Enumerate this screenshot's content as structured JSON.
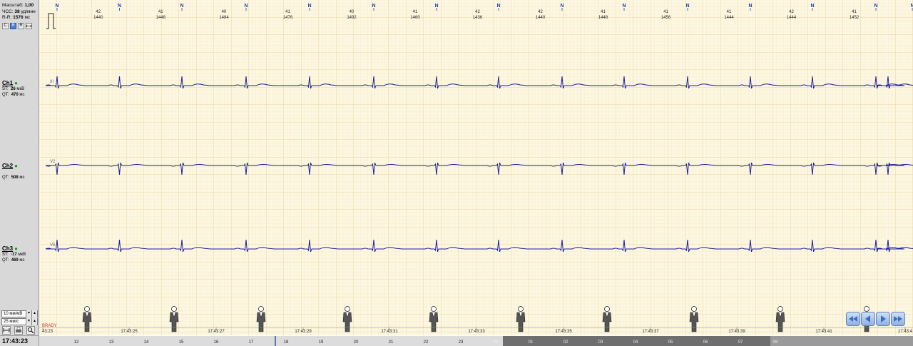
{
  "left_panel": {
    "scale_label": "Масштаб:",
    "scale_value": "1,00",
    "hr_label": "ЧСС:",
    "hr_value": "38",
    "hr_unit": "уд/мин",
    "rr_label": "R-R:",
    "rr_value": "1576",
    "rr_unit": "мс",
    "mode_buttons": [
      "C",
      "R",
      "R"
    ],
    "channels": [
      {
        "name": "Ch1",
        "st_label": "ST:",
        "st_value": "26",
        "st_unit": "мкВ",
        "qt_label": "QT:",
        "qt_value": "470",
        "qt_unit": "мс"
      },
      {
        "name": "Ch2",
        "st_label": "ST:",
        "st_value": "",
        "st_unit": "",
        "qt_label": "QT:",
        "qt_value": "508",
        "qt_unit": "мс"
      },
      {
        "name": "Ch3",
        "st_label": "ST:",
        "st_value": "-17",
        "st_unit": "мкВ",
        "qt_label": "QT:",
        "qt_value": "469",
        "qt_unit": "мс"
      }
    ],
    "amplitude_select": "10 мм/мВ",
    "speed_select": "25 мм/с",
    "current_time": "17:43:23"
  },
  "beats": [
    {
      "label": "N",
      "hr": "",
      "rr": ""
    },
    {
      "label": "N",
      "hr": "42",
      "rr": "1440"
    },
    {
      "label": "N",
      "hr": "41",
      "rr": "1448"
    },
    {
      "label": "N",
      "hr": "40",
      "rr": "1484"
    },
    {
      "label": "N",
      "hr": "41",
      "rr": "1476"
    },
    {
      "label": "N",
      "hr": "40",
      "rr": "1492"
    },
    {
      "label": "N",
      "hr": "41",
      "rr": "1460"
    },
    {
      "label": "N",
      "hr": "42",
      "rr": "1436"
    },
    {
      "label": "N",
      "hr": "42",
      "rr": "1440"
    },
    {
      "label": "N",
      "hr": "41",
      "rr": "1448"
    },
    {
      "label": "N",
      "hr": "41",
      "rr": "1456"
    },
    {
      "label": "N",
      "hr": "41",
      "rr": "1444"
    },
    {
      "label": "N",
      "hr": "42",
      "rr": "1444"
    },
    {
      "label": "N",
      "hr": "41",
      "rr": "1452"
    },
    {
      "label": "N",
      "hr": "",
      "rr": ""
    }
  ],
  "lead_labels": [
    "III",
    "V2",
    "V5"
  ],
  "event_label": "BRADY",
  "time_ticks": [
    "43:23",
    "17:43:25",
    "17:43:27",
    "17:43:29",
    "17:43:31",
    "17:43:33",
    "17:43:35",
    "17:43:37",
    "17:43:39",
    "17:43:41",
    "17:43:4"
  ],
  "overview_hours": [
    "12",
    "13",
    "14",
    "15",
    "16",
    "17",
    "18",
    "19",
    "20",
    "21",
    "22",
    "23",
    "00",
    "01",
    "02",
    "03",
    "04",
    "05",
    "06",
    "07",
    "08"
  ],
  "colors": {
    "grid_bg": "#fdf7e2",
    "grid_minor": "#f1e3b6",
    "grid_major": "#e6cf8e",
    "trace": "#1c1c9c",
    "beat_marker": "#1d3fb0",
    "event_text": "#c03030"
  },
  "icons": [
    "calibration-pulse-icon",
    "person-activity-icon",
    "rewind-icon",
    "play-icon",
    "forward-icon",
    "fast-forward-icon"
  ]
}
